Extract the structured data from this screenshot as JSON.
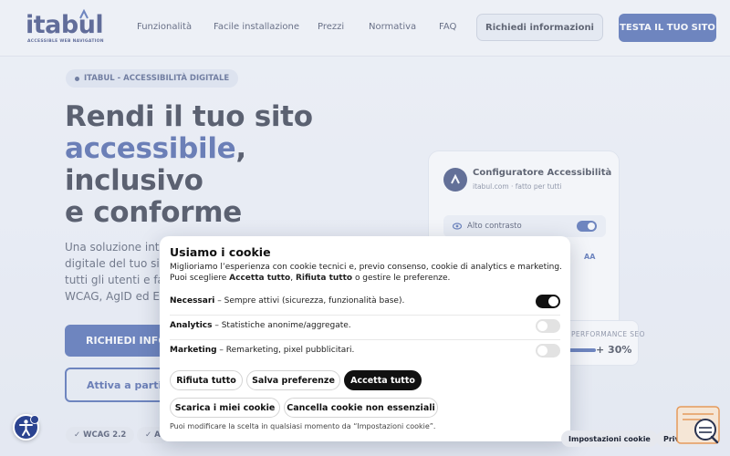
{
  "header": {
    "logo_text": "itabul",
    "logo_tagline": "ACCESSIBLE WEB NAVIGATION",
    "nav": [
      "Funzionalità",
      "Facile installazione",
      "Prezzi",
      "Normativa",
      "FAQ"
    ],
    "request_info_label": "Richiedi informazioni",
    "test_site_label": "TESTA IL TUO SITO"
  },
  "hero": {
    "pill": "ITABUL - ACCESSIBILITÀ DIGITALE",
    "title_line1": "Rendi il tuo sito",
    "title_accent": "accessibile",
    "title_comma": ",",
    "title_line3": "inclusivo",
    "title_line4": "e conforme",
    "paragraph_lines": [
      "Una soluzione intell",
      "digitale del tuo sito",
      "tutti gli utenti e fav",
      "WCAG, AgID ed Euro"
    ],
    "primary_button": "RICHIEDI INFO",
    "secondary_button": "Attiva a partir",
    "tags": [
      "✓ WCAG 2.2",
      "✓ A"
    ]
  },
  "configurator": {
    "title": "Configuratore Accessibilità",
    "subtitle": "itabul.com · fatto per tutti",
    "row_label": "Alto contrasto",
    "aa_label": "AA"
  },
  "seo_card": {
    "label": "PERFORMANCE SEO",
    "value": "+ 30%"
  },
  "cookie_modal": {
    "title": "Usiamo i cookie",
    "desc_line1": "Miglioriamo l’esperienza con cookie tecnici e, previo consenso, cookie di analytics e marketing.",
    "desc_line2_prefix": "Puoi scegliere ",
    "desc_accept": "Accetta tutto",
    "desc_sep": ", ",
    "desc_reject": "Rifiuta tutto",
    "desc_line2_suffix": " o gestire le preferenze.",
    "categories": [
      {
        "name": "Necessari",
        "desc": " – Sempre attivi (sicurezza, funzionalità base).",
        "enabled": true
      },
      {
        "name": "Analytics",
        "desc": " – Statistiche anonime/aggregate.",
        "enabled": false
      },
      {
        "name": "Marketing",
        "desc": " – Remarketing, pixel pubblicitari.",
        "enabled": false
      }
    ],
    "buttons": {
      "reject": "Rifiuta tutto",
      "save": "Salva preferenze",
      "accept": "Accetta tutto",
      "download": "Scarica i miei cookie",
      "delete_nonessential": "Cancella cookie non essenziali"
    },
    "footer_note": "Puoi modificare la scelta in qualsiasi momento da “Impostazioni cookie”."
  },
  "bottom_bar": {
    "cookie_settings": "Impostazioni cookie",
    "privacy": "Privacy Policy"
  },
  "colors": {
    "brand_blue": "#3354a6",
    "dark_button": "#111111",
    "logo_navy": "#1f2f6e",
    "help_orange": "#e59a5b"
  },
  "icons": {
    "accessibility": "accessibility-person-icon",
    "help": "help-chat-icon",
    "eye": "eye-icon"
  }
}
